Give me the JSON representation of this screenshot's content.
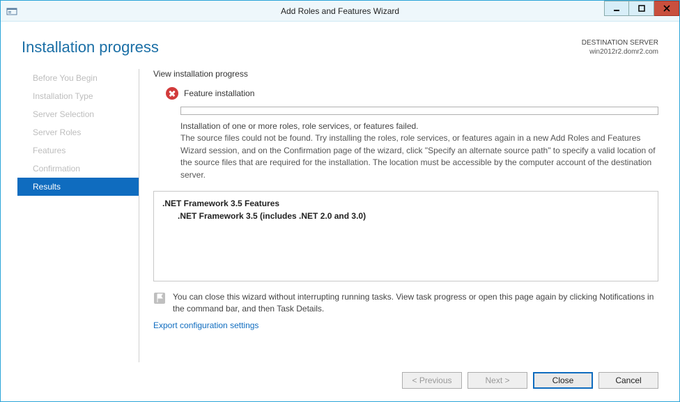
{
  "window": {
    "title": "Add Roles and Features Wizard"
  },
  "header": {
    "page_title": "Installation progress",
    "dest_label": "DESTINATION SERVER",
    "dest_server": "win2012r2.domr2.com"
  },
  "sidebar": {
    "steps": [
      {
        "label": "Before You Begin"
      },
      {
        "label": "Installation Type"
      },
      {
        "label": "Server Selection"
      },
      {
        "label": "Server Roles"
      },
      {
        "label": "Features"
      },
      {
        "label": "Confirmation"
      },
      {
        "label": "Results"
      }
    ],
    "active_index": 6
  },
  "content": {
    "heading": "View installation progress",
    "status_label": "Feature installation",
    "message_line1": "Installation of one or more roles, role services, or features failed.",
    "message_rest": "The source files could not be found. Try installing the roles, role services, or features again in a new Add Roles and Features Wizard session, and on the Confirmation page of the wizard, click \"Specify an alternate source path\" to specify a valid location of the source files that are required for the installation. The location must be accessible by the computer account of the destination server.",
    "feature_parent": ".NET Framework 3.5 Features",
    "feature_child": ".NET Framework 3.5 (includes .NET 2.0 and 3.0)",
    "info_text": "You can close this wizard without interrupting running tasks. View task progress or open this page again by clicking Notifications in the command bar, and then Task Details.",
    "export_link": "Export configuration settings"
  },
  "footer": {
    "previous": "< Previous",
    "next": "Next >",
    "close": "Close",
    "cancel": "Cancel"
  }
}
